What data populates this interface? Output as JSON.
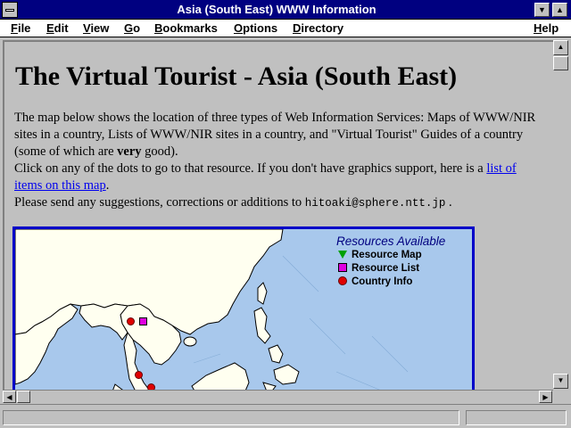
{
  "window": {
    "title": "Asia (South East) WWW Information",
    "minimize_glyph": "▼",
    "maximize_glyph": "▲"
  },
  "menu": {
    "file": "ile",
    "file_u": "F",
    "edit": "dit",
    "edit_u": "E",
    "view": "iew",
    "view_u": "V",
    "go": "o",
    "go_u": "G",
    "bookmarks": "ookmarks",
    "bookmarks_u": "B",
    "options": "ptions",
    "options_u": "O",
    "directory": "irectory",
    "directory_u": "D",
    "help": "elp",
    "help_u": "H"
  },
  "page": {
    "title": "The Virtual Tourist - Asia (South East)",
    "intro_1": "The map below shows the location of three types of Web Information Services: Maps of WWW/NIR sites in a country, Lists of WWW/NIR sites in a country, and \"Virtual Tourist\" Guides of a country (some of which are ",
    "intro_bold": "very",
    "intro_2": " good).",
    "click_1": "Click on any of the dots to go to that resource. If you don't have graphics support, here is a ",
    "click_link": "list of items on this map",
    "click_2": ".",
    "send_1": "Please send any suggestions, corrections or additions to ",
    "send_email": "hitoaki@sphere.ntt.jp",
    "send_2": " ."
  },
  "legend": {
    "title": "Resources Available",
    "map": "Resource Map",
    "list": "Resource List",
    "info": "Country Info"
  },
  "colors": {
    "title_bar": "#000080",
    "sea": "#a8c8ec",
    "land": "#fffff0",
    "link": "#0000ee",
    "map_border": "#0000c8"
  },
  "icons": {
    "scroll_up": "▲",
    "scroll_down": "▼",
    "scroll_left": "◀",
    "scroll_right": "▶"
  }
}
